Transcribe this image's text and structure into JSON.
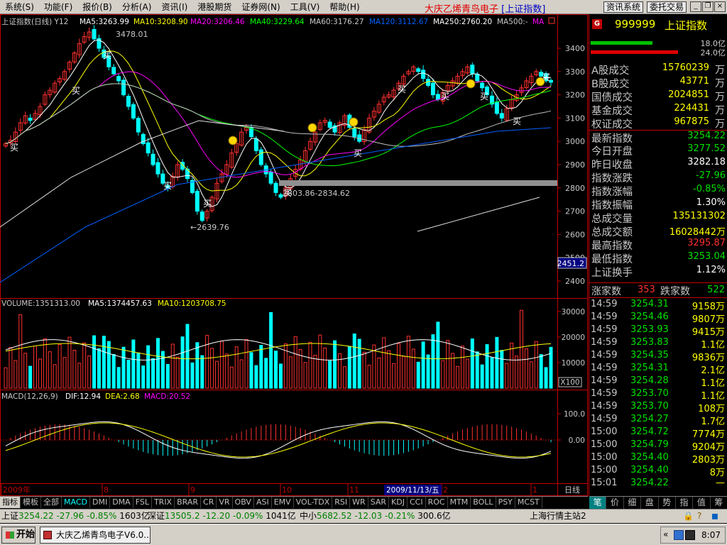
{
  "menu": [
    "系统(S)",
    "功能(F)",
    "报价(B)",
    "分析(A)",
    "资讯(I)",
    "港股期货",
    "证券网(N)",
    "工具(V)",
    "帮助(H)"
  ],
  "app_title": {
    "main": "大庆乙烯青鸟电子",
    "sub": "[上证指数]"
  },
  "top_buttons": {
    "info": "资讯系统",
    "trade": "委托交易"
  },
  "window_buttons": {
    "minimize": "_",
    "restore": "❐",
    "close": "×"
  },
  "chart_header": {
    "name": "上证指数(日线) Y12",
    "ma5": "MA5:3263.99",
    "ma10": "MA10:3208.90",
    "ma20": "MA20:3206.46",
    "ma40": "MA40:3229.64",
    "ma60": "MA60:3176.27",
    "ma120": "MA120:3112.67",
    "ma250": "MA250:2760.20",
    "ma500": "MA500:-",
    "ma_extra": "MA"
  },
  "chart_colors": {
    "ma5": "#ffffff",
    "ma10": "#ffff00",
    "ma20": "#ff00ff",
    "ma40": "#00ff00",
    "ma60": "#c0c0c0",
    "ma120": "#0060ff",
    "ma250": "#ffffff",
    "up": "#ff3030",
    "down": "#00ffff",
    "axis": "#c00000"
  },
  "price_axis": [
    "3400",
    "3300",
    "3200",
    "3100",
    "3000",
    "2900",
    "2800",
    "2700",
    "2600",
    "2500",
    "2400"
  ],
  "price_annotations": {
    "high": "3478.01",
    "low": "←2639.76",
    "range": "2803.86-2834.62",
    "current_marker": "2451.2"
  },
  "buy_label": "买",
  "volume": {
    "header": "VOLUME:1351313.00",
    "ma5": "MA5:1374457.63",
    "ma10": "MA10:1203708.75",
    "axis": [
      "30000",
      "20000",
      "10000"
    ],
    "unit": "X100"
  },
  "macd": {
    "header": "MACD(12,26,9)",
    "dif": "DIF:12.94",
    "dea": "DEA:2.68",
    "macd": "MACD:20.52",
    "axis": [
      "100.0",
      "0.00"
    ]
  },
  "date_axis": {
    "year": "2009年",
    "m8": "8",
    "m9": "9",
    "m10": "10",
    "m11": "11",
    "m1": "1",
    "cursor": "2009/11/13/五",
    "next": "2",
    "period": "日线"
  },
  "indicator_tabs": [
    "指标",
    "模板",
    "全部",
    "MACD",
    "DMI",
    "DMA",
    "FSL",
    "TRIX",
    "BRAR",
    "CR",
    "VR",
    "OBV",
    "ASI",
    "EMV",
    "VOL-TDX",
    "RSI",
    "WR",
    "SAR",
    "KDJ",
    "CCI",
    "ROC",
    "MTM",
    "BOLL",
    "PSY",
    "MCST"
  ],
  "panel": {
    "badge": "G",
    "code": "999999",
    "name": "上证指数",
    "bar1": "18.0亿",
    "bar2": "24.0亿",
    "bar1_fill": 0.62,
    "bar2_fill": 0.88
  },
  "quotes_a": [
    {
      "label": "A股成交",
      "value": "15760239",
      "unit": "万",
      "color": "#ffff00"
    },
    {
      "label": "B股成交",
      "value": "43771",
      "unit": "万",
      "color": "#ffff00"
    },
    {
      "label": "国债成交",
      "value": "2024851",
      "unit": "万",
      "color": "#ffff00"
    },
    {
      "label": "基金成交",
      "value": "224431",
      "unit": "万",
      "color": "#ffff00"
    },
    {
      "label": "权证成交",
      "value": "967875",
      "unit": "万",
      "color": "#ffff00"
    }
  ],
  "quotes_b": [
    {
      "label": "最新指数",
      "value": "3254.22",
      "color": "#00e000"
    },
    {
      "label": "今日开盘",
      "value": "3277.52",
      "color": "#00e000"
    },
    {
      "label": "昨日收盘",
      "value": "3282.18",
      "color": "#ffffff"
    },
    {
      "label": "指数涨跌",
      "value": "-27.96",
      "color": "#00e000"
    },
    {
      "label": "指数涨幅",
      "value": "-0.85%",
      "color": "#00e000"
    },
    {
      "label": "指数振幅",
      "value": "1.30%",
      "color": "#ffffff"
    },
    {
      "label": "总成交量",
      "value": "135131302",
      "color": "#ffff00"
    },
    {
      "label": "总成交额",
      "value": "16028442万",
      "color": "#ffff00"
    },
    {
      "label": "最高指数",
      "value": "3295.87",
      "color": "#ff3030"
    },
    {
      "label": "最低指数",
      "value": "3253.04",
      "color": "#00e000"
    },
    {
      "label": "上证换手",
      "value": "1.12%",
      "color": "#ffffff"
    }
  ],
  "updown": {
    "up_label": "涨家数",
    "up": "353",
    "down_label": "跌家数",
    "down": "522"
  },
  "ticks": [
    {
      "time": "14:59",
      "price": "3254.31",
      "vol": "9158万"
    },
    {
      "time": "14:59",
      "price": "3254.46",
      "vol": "9807万"
    },
    {
      "time": "14:59",
      "price": "3253.93",
      "vol": "9415万"
    },
    {
      "time": "14:59",
      "price": "3253.83",
      "vol": "1.1亿"
    },
    {
      "time": "14:59",
      "price": "3254.35",
      "vol": "9836万"
    },
    {
      "time": "14:59",
      "price": "3254.31",
      "vol": "2.1亿"
    },
    {
      "time": "14:59",
      "price": "3254.28",
      "vol": "1.1亿"
    },
    {
      "time": "14:59",
      "price": "3253.70",
      "vol": "1.1亿"
    },
    {
      "time": "14:59",
      "price": "3253.70",
      "vol": "108万"
    },
    {
      "time": "14:59",
      "price": "3254.27",
      "vol": "1.7亿"
    },
    {
      "time": "15:00",
      "price": "3254.72",
      "vol": "7774万"
    },
    {
      "time": "15:00",
      "price": "3254.79",
      "vol": "9204万"
    },
    {
      "time": "15:00",
      "price": "3254.40",
      "vol": "2803万"
    },
    {
      "time": "15:00",
      "price": "3254.40",
      "vol": "8万"
    },
    {
      "time": "15:01",
      "price": "3254.22",
      "vol": "—"
    }
  ],
  "panel_tabs": [
    "笔",
    "价",
    "细",
    "盘",
    "势",
    "指",
    "值",
    "筹"
  ],
  "status": {
    "sh_label": "上证",
    "sh_val": "3254.22",
    "sh_chg": "-27.96",
    "sh_pct": "-0.85%",
    "sh_amt": "1603亿",
    "sz_label": "深证",
    "sz_val": "13505.2",
    "sz_chg": "-12.20",
    "sz_pct": "-0.09%",
    "sz_amt": "1041亿",
    "zx_label": "中小",
    "zx_val": "5682.52",
    "zx_chg": "-12.03",
    "zx_pct": "-0.21%",
    "zx_amt": "300.6亿",
    "station": "上海行情主站2"
  },
  "taskbar": {
    "start": "开始",
    "task": "大庆乙烯青鸟电子V6.0...",
    "clock": "8:07",
    "chev": "«"
  }
}
